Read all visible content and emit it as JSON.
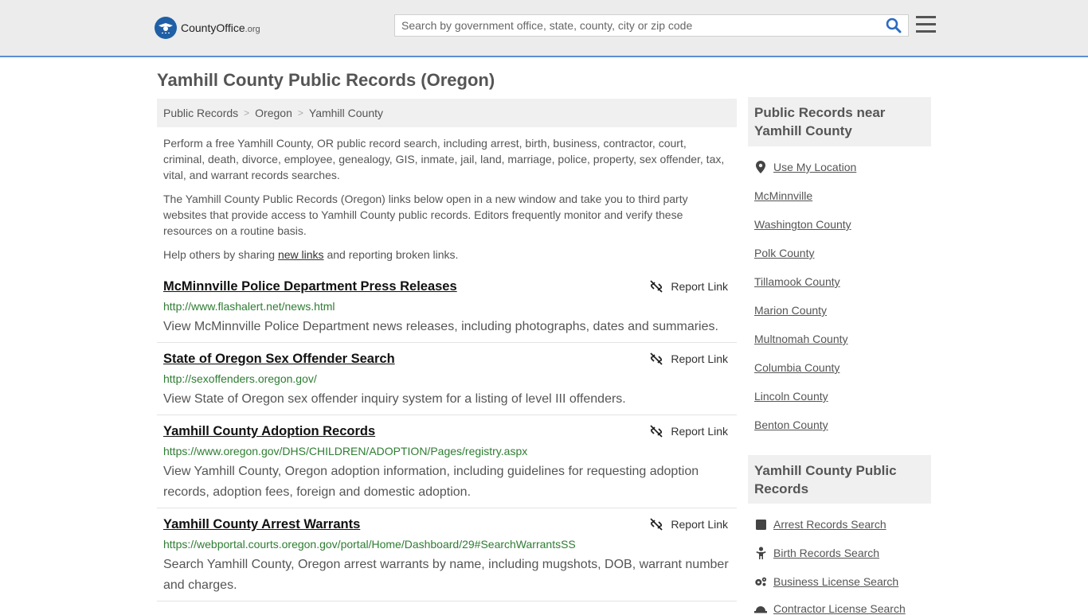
{
  "header": {
    "logo": {
      "county": "County",
      "office": "Office",
      "tld": ".org"
    },
    "search_placeholder": "Search by government office, state, county, city or zip code"
  },
  "page": {
    "title": "Yamhill County Public Records (Oregon)",
    "breadcrumb": [
      "Public Records",
      "Oregon",
      "Yamhill County"
    ],
    "intro1": "Perform a free Yamhill County, OR public record search, including arrest, birth, business, contractor, court, criminal, death, divorce, employee, genealogy, GIS, inmate, jail, land, marriage, police, property, sex offender, tax, vital, and warrant records searches.",
    "intro2": "The Yamhill County Public Records (Oregon) links below open in a new window and take you to third party websites that provide access to Yamhill County public records. Editors frequently monitor and verify these resources on a routine basis.",
    "help_prefix": "Help others by sharing ",
    "help_link": "new links",
    "help_suffix": " and reporting broken links."
  },
  "records": [
    {
      "title": "McMinnville Police Department Press Releases",
      "url": "http://www.flashalert.net/news.html",
      "desc": "View McMinnville Police Department news releases, including photographs, dates and summaries.",
      "report": "Report Link"
    },
    {
      "title": "State of Oregon Sex Offender Search",
      "url": "http://sexoffenders.oregon.gov/",
      "desc": "View State of Oregon sex offender inquiry system for a listing of level III offenders.",
      "report": "Report Link"
    },
    {
      "title": "Yamhill County Adoption Records",
      "url": "https://www.oregon.gov/DHS/CHILDREN/ADOPTION/Pages/registry.aspx",
      "desc": "View Yamhill County, Oregon adoption information, including guidelines for requesting adoption records, adoption fees, foreign and domestic adoption.",
      "report": "Report Link"
    },
    {
      "title": "Yamhill County Arrest Warrants",
      "url": "https://webportal.courts.oregon.gov/portal/Home/Dashboard/29#SearchWarrantsSS",
      "desc": "Search Yamhill County, Oregon arrest warrants by name, including mugshots, DOB, warrant number and charges.",
      "report": "Report Link"
    }
  ],
  "sidebar": {
    "nearby_title": "Public Records near Yamhill County",
    "use_location": "Use My Location",
    "nearby": [
      "McMinnville",
      "Washington County",
      "Polk County",
      "Tillamook County",
      "Marion County",
      "Multnomah County",
      "Columbia County",
      "Lincoln County",
      "Benton County"
    ],
    "records_title": "Yamhill County Public Records",
    "records_links": [
      {
        "label": "Arrest Records Search",
        "icon": "square-icon"
      },
      {
        "label": "Birth Records Search",
        "icon": "baby-icon"
      },
      {
        "label": "Business License Search",
        "icon": "gears-icon"
      },
      {
        "label": "Contractor License Search",
        "icon": "hardhat-icon"
      }
    ]
  }
}
